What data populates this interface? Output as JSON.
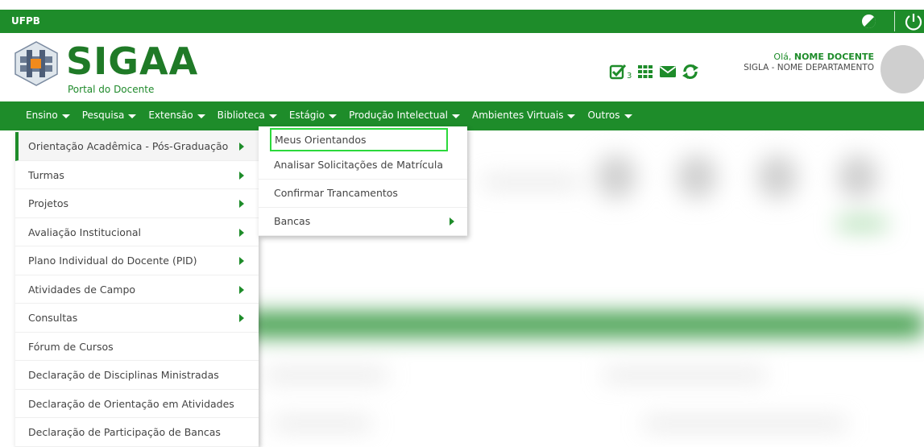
{
  "topbar": {
    "institution": "UFPB"
  },
  "header": {
    "brand": "SIGAA",
    "portal": "Portal do Docente",
    "notification_count": "3",
    "greeting_prefix": "Olá, ",
    "user_name": "NOME DOCENTE",
    "department": "SIGLA - NOME DEPARTAMENTO"
  },
  "nav": {
    "items": [
      {
        "label": "Ensino"
      },
      {
        "label": "Pesquisa"
      },
      {
        "label": "Extensão"
      },
      {
        "label": "Biblioteca"
      },
      {
        "label": "Estágio"
      },
      {
        "label": "Produção Intelectual"
      },
      {
        "label": "Ambientes Virtuais"
      },
      {
        "label": "Outros"
      }
    ]
  },
  "menu": {
    "items": [
      {
        "label": "Orientação Acadêmica - Pós-Graduação"
      },
      {
        "label": "Turmas"
      },
      {
        "label": "Projetos"
      },
      {
        "label": "Avaliação Institucional"
      },
      {
        "label": "Plano Individual do Docente (PID)"
      },
      {
        "label": "Atividades de Campo"
      },
      {
        "label": "Consultas"
      },
      {
        "label": "Fórum de Cursos"
      },
      {
        "label": "Declaração de Disciplinas Ministradas"
      },
      {
        "label": "Declaração de Orientação em Atividades"
      },
      {
        "label": "Declaração de Participação de Bancas"
      }
    ]
  },
  "submenu": {
    "items": [
      {
        "label": "Meus Orientandos"
      },
      {
        "label": "Analisar Solicitações de Matrícula"
      },
      {
        "label": "Confirmar Trancamentos"
      },
      {
        "label": "Bancas"
      }
    ]
  },
  "colors": {
    "primary": "#1e8c2a",
    "highlight": "#2bd93b"
  },
  "icons": [
    "contrast-icon",
    "power-icon",
    "checkbox-icon",
    "grid-icon",
    "mail-icon",
    "refresh-icon",
    "chevron-right-icon",
    "caret-down-icon"
  ]
}
